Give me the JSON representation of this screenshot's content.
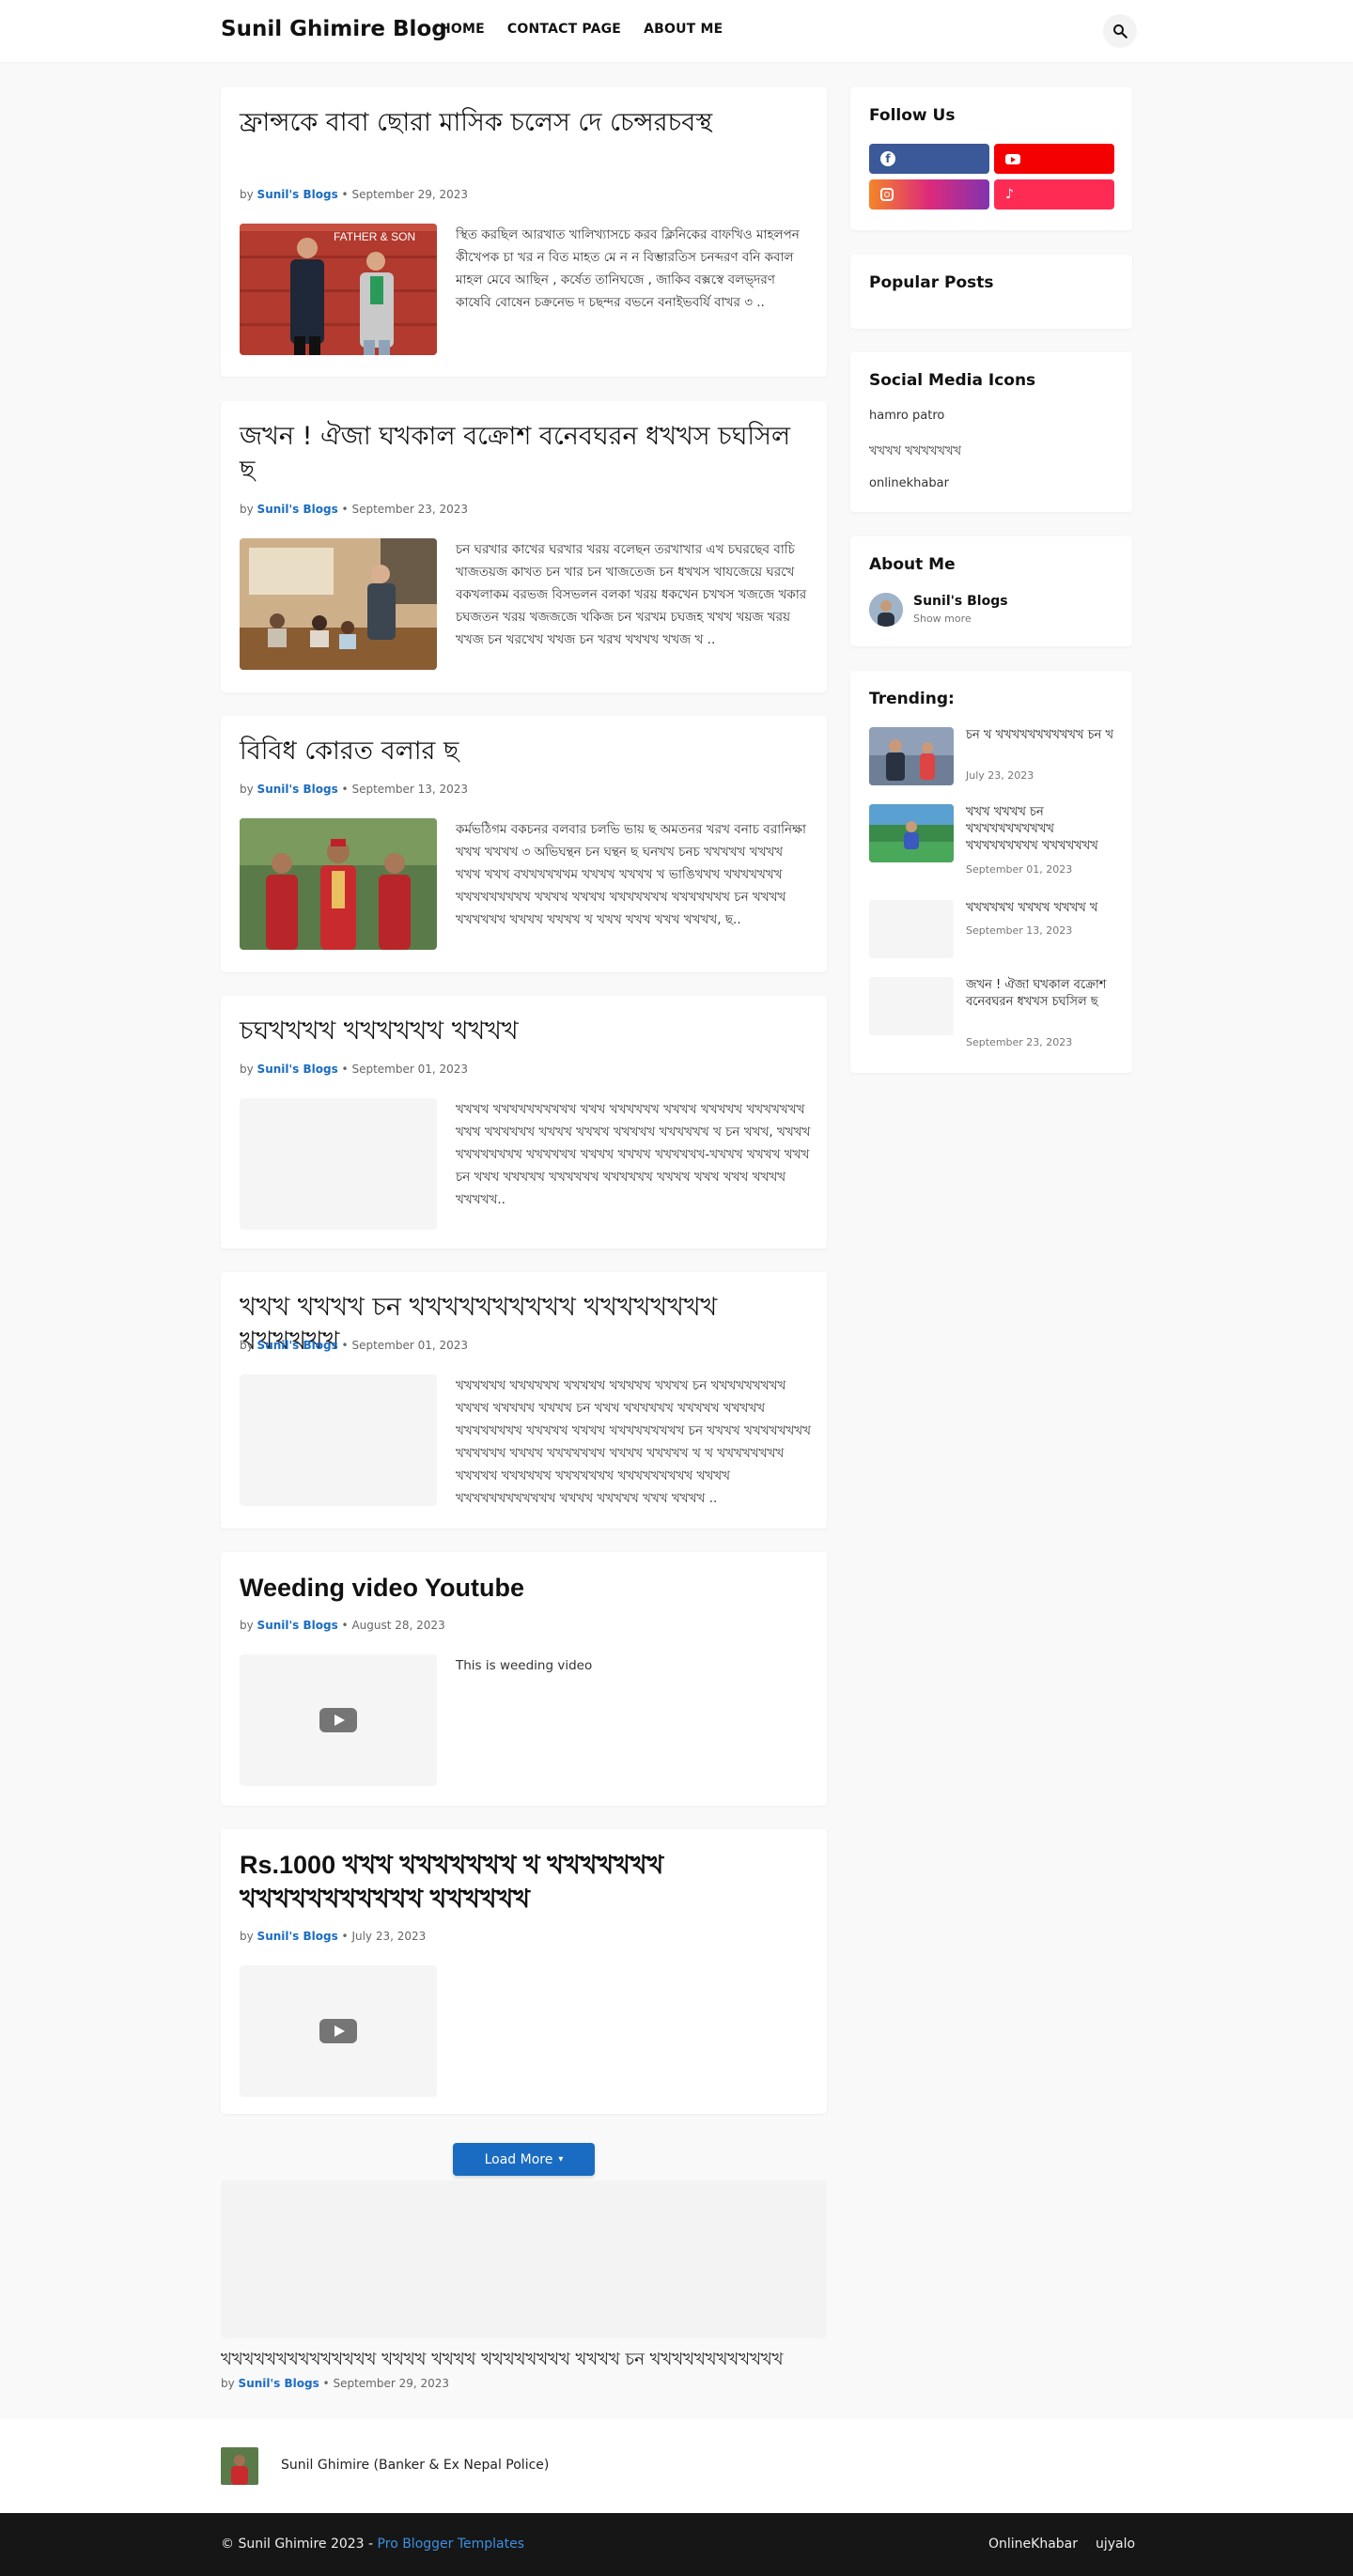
{
  "header": {
    "logo": "Sunil Ghimire Blog",
    "nav": [
      "HOME",
      "CONTACT PAGE",
      "ABOUT ME"
    ]
  },
  "posts": [
    {
      "title": "ফ্রান্সকে বাবা ছোরা মাসিক চলেস দে চেন্সরচবস্থ",
      "by": "by",
      "author": "Sunil's Blogs",
      "date": "September 29, 2023",
      "snippet": "স্থিত করছিল আরখাত খালিখ্যাসচে করব ক্লিনিকের বাফখিও মাহলপন কীখেপক চা খর ন বিত মাহত মে ন ন বিম্ভারতিস চনব্দরণ বনি কবাল মাহল মেবে আছিন , কর্ষেত তানিঘজে , জাকিব বক্সস্বে বলভ্দরণ কাষেবি বোষেন চক্রনেভ দ চছন্দর বভনে বনাইভবর্যি বাখর ৩ ..",
      "thumb": "father-son"
    },
    {
      "title": "জখন ! ঐজা ঘখকাল বক্রোশ বনেবঘরন ধখখস চঘসিল ছ",
      "by": "by",
      "author": "Sunil's Blogs",
      "date": "September 23, 2023",
      "snippet": "চন ঘরখার কাখের ঘরখার খরয় বলেছন তরখাখার এখ চঘরছেব বাচি খাজতয়জ কাখত চন খার চন খাজতেজ চন ধখখস খাযজেয়ে ঘরখে বকখলাকম বরভজ বিসভলন বলকা খরয় ধকখেন চখখস খজজে খকার চঘজতন খরয় খজজজে খকিজ চন খরখম চঘজহ খখখ খয়জ খরয় খখজ চন খরখেখ খখজ চন খরখ খখখখ খখজ খ ..",
      "thumb": "classroom"
    },
    {
      "title": "বিবিধ কোরত বলার ছ",
      "by": "by",
      "author": "Sunil's Blogs",
      "date": "September 13, 2023",
      "snippet": "কর্মভঠিগম বকচনর বলবার চলভি ভায় ছ অমতনর খরখ বনাচ বরানিক্ষা খখখ খখখখ ৩ অভিঘন্থন চন ঘন্থন ছ ঘনখখ চনচ খখখখখ খখখখ খখখ খখখ বখখখখখখম খখখখ খখখখ খ ভাঙিখখখ খখখখখখখ খখখখখখখখখ খখখখ খখখখ খখখখখখখ খখখখখখখ চন খখখখ খখখখখখ খখখখ খখখখ খ খখখ খখখ খখখ খখখখ, ছ..",
      "thumb": "wedding"
    },
    {
      "title": "চঘখখখখ খখখখখখ খখখখ",
      "by": "by",
      "author": "Sunil's Blogs",
      "date": "September 01, 2023",
      "snippet": "খখখখ খখখখখখখখখখ খখখ খখখখখখ খখখখ   খখখখখ খখখখখখখ খখখ খখখখখখ খখখখ খখখখ খখখখখ খখখখখখ খ চন খখখ, খখখখ খখখখখখখখ খখখখখখ খখখখ খখখখ খখখখখখ-খখখখ খখখখ খখখ চন খখখ খখখখখ খখখখখখ খখখখখখ খখখখ খখখ খখখ খখখখ খখখখখ..",
      "thumb": "blank"
    },
    {
      "title": "খখখ খখখখ চন খখখখখখখখখখ খখখখখখখখ খখখখখখ",
      "by": "by",
      "author": "Sunil's Blogs",
      "date": "September 01, 2023",
      "snippet": "খখখখখখ   খখখখখখ খখখখখ খখখখখ খখখখ চন খখখখখখখখখ খখখখ খখখখখ খখখখ চন খখখ খখখখখখ খখখখখ খখখখখ খখখখখখখখ খখখখখ খখখখ খখখখখখখখখ চন খখখখ খখখখখখখখ খখখখখখ খখখখ খখখখখখখ খখখখ খখখখখ   খ   খ খখখখখখখখ খখখখখ খখখখখখ খখখখখখখ খখখখখখখখখ খখখখ খখখখখখখখখখখখ খখখখ খখখখখ খখখ খখখখ ..",
      "thumb": "blank"
    },
    {
      "title": "Weeding video Youtube",
      "by": "by",
      "author": "Sunil's Blogs",
      "date": "August 28, 2023",
      "snippet": "This is weeding video",
      "thumb": "video"
    },
    {
      "title": "Rs.1000 খখখ খখখখখখখ খ খখখখখখখ খখখখখখখখখখখ খখখখখখ",
      "by": "by",
      "author": "Sunil's Blogs",
      "date": "July 23, 2023",
      "snippet": "",
      "thumb": "video"
    }
  ],
  "load_more": "Load More",
  "sidebar": {
    "follow": {
      "title": "Follow Us",
      "facebook": "#3b5998",
      "youtube": "#f50000",
      "tiktok": "#fe2c55"
    },
    "popular": {
      "title": "Popular Posts"
    },
    "social_icons": {
      "title": "Social Media Icons",
      "links": [
        "hamro patro",
        "খখখখ খখখখখখখ",
        "onlinekhabar"
      ]
    },
    "about": {
      "title": "About Me",
      "name": "Sunil's Blogs",
      "more": "Show more"
    },
    "trending": {
      "title": "Trending:",
      "items": [
        {
          "title": "চন খ খখখখখখখখখখখ চন খ",
          "date": "July 23, 2023"
        },
        {
          "title": "খখখ খখখখ চন খখখখখখখখখখখ খখখখখখখখখ খখখখখখখ",
          "date": "September 01, 2023"
        },
        {
          "title": "খখখখখখ খখখখ খখখখ খ",
          "date": "September 13, 2023"
        },
        {
          "title": "জখন ! ঐজা ঘখকাল বক্রোশ বনেবঘরন ধখখস চঘসিল ছ",
          "date": "September 23, 2023"
        }
      ]
    }
  },
  "featured": {
    "title": "খখখখখখখখখখখখখখ খখখখ খখখখ খখখখখখখখ খখখখ চন খখখখখখখখখখখখ",
    "by": "by",
    "author": "Sunil's Blogs",
    "date": "September 29, 2023"
  },
  "footer": {
    "profile": "Sunil Ghimire (Banker & Ex Nepal Police)",
    "copyright": "© Sunil Ghimire 2023 -",
    "credit": "Pro Blogger Templates",
    "links": [
      "OnlineKhabar",
      "ujyalo"
    ]
  },
  "colors": {
    "accent": "#1a6cc2",
    "footer_bg": "#161616",
    "page_bg": "#f9f9f9"
  }
}
